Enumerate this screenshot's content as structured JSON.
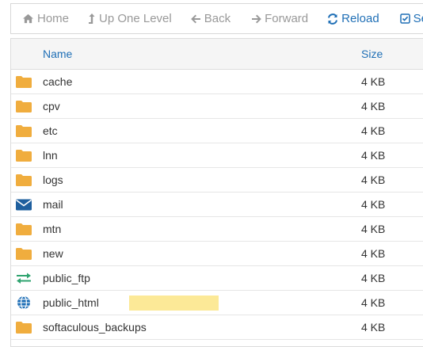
{
  "toolbar": {
    "home_label": "Home",
    "up_label": "Up One Level",
    "back_label": "Back",
    "forward_label": "Forward",
    "reload_label": "Reload",
    "select_label": "Sele"
  },
  "table": {
    "headers": {
      "name": "Name",
      "size": "Size"
    },
    "rows": [
      {
        "name": "cache",
        "size": "4 KB",
        "icon": "folder-icon"
      },
      {
        "name": "cpv",
        "size": "4 KB",
        "icon": "folder-icon"
      },
      {
        "name": "etc",
        "size": "4 KB",
        "icon": "folder-icon"
      },
      {
        "name": "lnn",
        "size": "4 KB",
        "icon": "folder-icon"
      },
      {
        "name": "logs",
        "size": "4 KB",
        "icon": "folder-icon"
      },
      {
        "name": "mail",
        "size": "4 KB",
        "icon": "envelope-icon"
      },
      {
        "name": "mtn",
        "size": "4 KB",
        "icon": "folder-icon"
      },
      {
        "name": "new",
        "size": "4 KB",
        "icon": "folder-icon"
      },
      {
        "name": "public_ftp",
        "size": "4 KB",
        "icon": "transfer-arrows-icon"
      },
      {
        "name": "public_html",
        "size": "4 KB",
        "icon": "globe-icon"
      },
      {
        "name": "softaculous_backups",
        "size": "4 KB",
        "icon": "folder-icon"
      }
    ]
  },
  "colors": {
    "accent": "#1f6fb6",
    "muted": "#999999",
    "folder": "#f0ad3e",
    "envelope": "#1e5f9e",
    "transfer": "#2ea36f",
    "highlight": "#fce997"
  }
}
